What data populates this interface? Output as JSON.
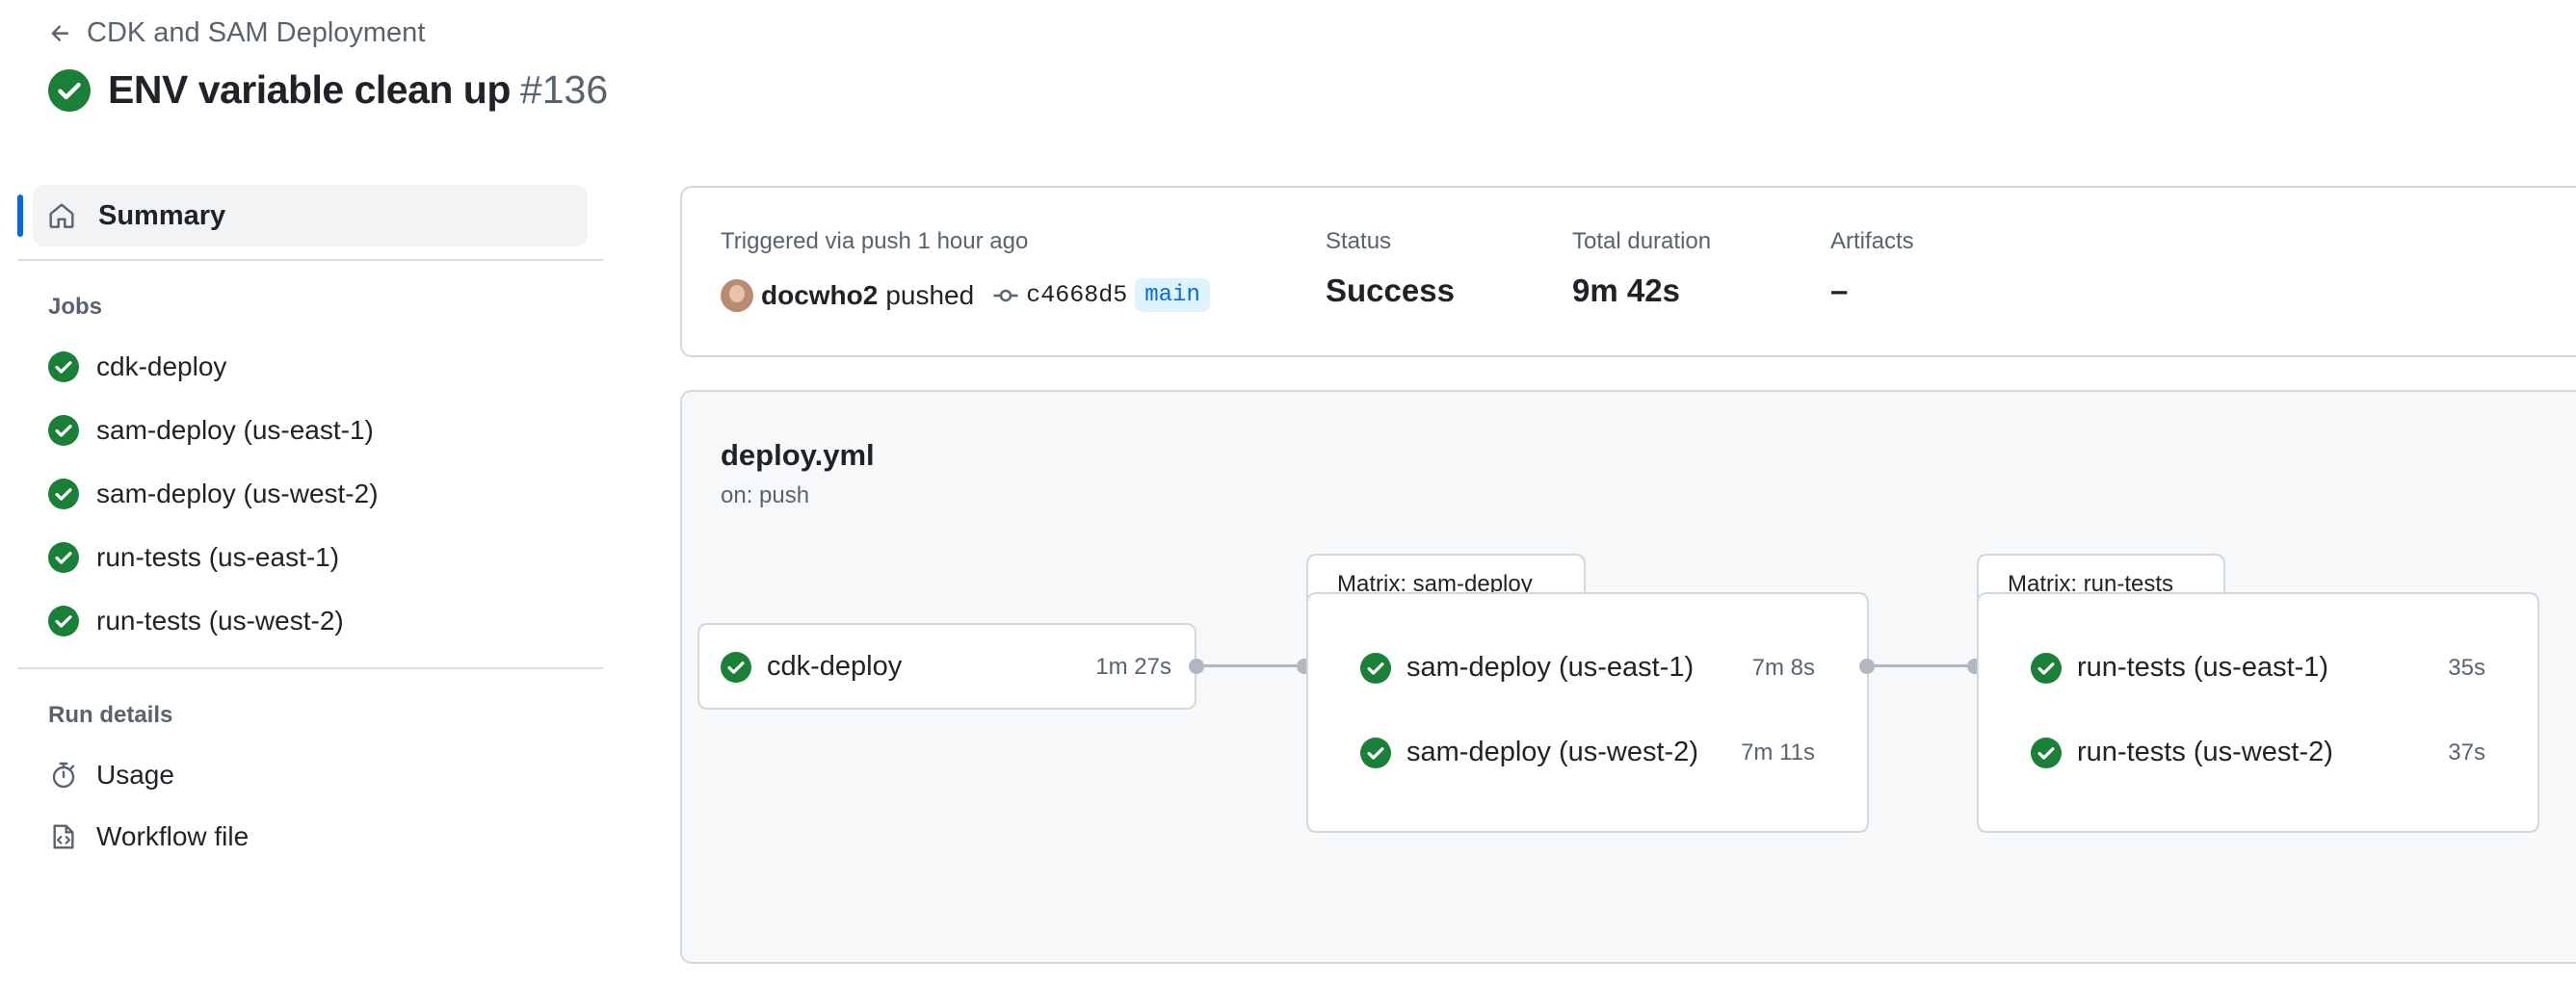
{
  "header": {
    "back_label": "CDK and SAM Deployment",
    "title": "ENV variable clean up",
    "run_number": "#136"
  },
  "sidebar": {
    "summary_label": "Summary",
    "jobs_title": "Jobs",
    "jobs": [
      {
        "label": "cdk-deploy",
        "status": "success"
      },
      {
        "label": "sam-deploy (us-east-1)",
        "status": "success"
      },
      {
        "label": "sam-deploy (us-west-2)",
        "status": "success"
      },
      {
        "label": "run-tests (us-east-1)",
        "status": "success"
      },
      {
        "label": "run-tests (us-west-2)",
        "status": "success"
      }
    ],
    "run_details_title": "Run details",
    "run_details": [
      {
        "label": "Usage",
        "icon": "stopwatch-icon"
      },
      {
        "label": "Workflow file",
        "icon": "file-code-icon"
      }
    ]
  },
  "summary": {
    "trigger_text": "Triggered via push 1 hour ago",
    "actor": "docwho2",
    "action": "pushed",
    "commit_sha": "c4668d5",
    "branch": "main",
    "status_label": "Status",
    "status_value": "Success",
    "duration_label": "Total duration",
    "duration_value": "9m 42s",
    "artifacts_label": "Artifacts",
    "artifacts_value": "–"
  },
  "workflow": {
    "file": "deploy.yml",
    "trigger": "on: push",
    "cdk_job": {
      "name": "cdk-deploy",
      "duration": "1m 27s"
    },
    "matrix_sam": {
      "title": "Matrix: sam-deploy",
      "jobs": [
        {
          "name": "sam-deploy (us-east-1)",
          "duration": "7m 8s"
        },
        {
          "name": "sam-deploy (us-west-2)",
          "duration": "7m 11s"
        }
      ]
    },
    "matrix_tests": {
      "title": "Matrix: run-tests",
      "jobs": [
        {
          "name": "run-tests (us-east-1)",
          "duration": "35s"
        },
        {
          "name": "run-tests (us-west-2)",
          "duration": "37s"
        }
      ]
    }
  },
  "colors": {
    "success": "#1a7f37",
    "accent": "#0969da"
  }
}
